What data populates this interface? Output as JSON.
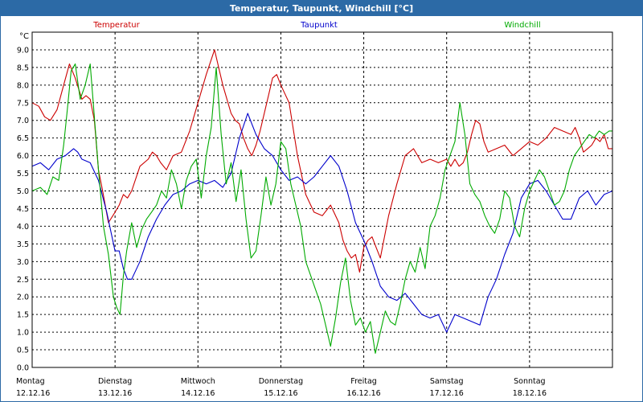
{
  "window": {
    "title": "Temperatur, Taupunkt, Windchill [°C]"
  },
  "chart_data": {
    "type": "line",
    "title": "Temperatur, Taupunkt, Windchill [°C]",
    "ylabel": "°C",
    "ylim": [
      0,
      9.5
    ],
    "yticks": [
      "0.0",
      "0.5",
      "1.0",
      "1.5",
      "2.0",
      "2.5",
      "3.0",
      "3.5",
      "4.0",
      "4.5",
      "5.0",
      "5.5",
      "6.0",
      "6.5",
      "7.0",
      "7.5",
      "8.0",
      "8.5",
      "9.0"
    ],
    "xlim": [
      0,
      7
    ],
    "days": [
      {
        "day": "Montag",
        "date": "12.12.16"
      },
      {
        "day": "Dienstag",
        "date": "13.12.16"
      },
      {
        "day": "Mittwoch",
        "date": "14.12.16"
      },
      {
        "day": "Donnerstag",
        "date": "15.12.16"
      },
      {
        "day": "Freitag",
        "date": "16.12.16"
      },
      {
        "day": "Samstag",
        "date": "17.12.16"
      },
      {
        "day": "Sonntag",
        "date": "18.12.16"
      }
    ],
    "grid": true,
    "series": [
      {
        "name": "Temperatur",
        "color": "#cc0000",
        "x": [
          0.0,
          0.08,
          0.15,
          0.22,
          0.3,
          0.38,
          0.45,
          0.52,
          0.6,
          0.65,
          0.7,
          0.75,
          0.8,
          0.85,
          0.92,
          1.0,
          1.05,
          1.1,
          1.15,
          1.2,
          1.3,
          1.4,
          1.45,
          1.5,
          1.55,
          1.62,
          1.7,
          1.8,
          1.9,
          2.0,
          2.1,
          2.2,
          2.3,
          2.4,
          2.45,
          2.5,
          2.55,
          2.6,
          2.65,
          2.7,
          2.75,
          2.8,
          2.85,
          2.9,
          2.95,
          3.0,
          3.1,
          3.2,
          3.3,
          3.4,
          3.5,
          3.6,
          3.7,
          3.75,
          3.8,
          3.85,
          3.9,
          3.95,
          4.0,
          4.05,
          4.1,
          4.15,
          4.2,
          4.3,
          4.4,
          4.5,
          4.6,
          4.7,
          4.8,
          4.9,
          5.0,
          5.05,
          5.1,
          5.15,
          5.2,
          5.25,
          5.3,
          5.35,
          5.4,
          5.45,
          5.5,
          5.6,
          5.7,
          5.8,
          5.9,
          6.0,
          6.1,
          6.2,
          6.3,
          6.4,
          6.5,
          6.55,
          6.6,
          6.65,
          6.7,
          6.75,
          6.8,
          6.85,
          6.9,
          6.95,
          7.0
        ],
        "y": [
          7.5,
          7.4,
          7.1,
          7.0,
          7.3,
          8.0,
          8.6,
          8.2,
          7.6,
          7.7,
          7.6,
          7.0,
          5.6,
          5.0,
          4.1,
          4.4,
          4.6,
          4.9,
          4.8,
          5.0,
          5.7,
          5.9,
          6.1,
          6.0,
          5.8,
          5.6,
          6.0,
          6.1,
          6.7,
          7.5,
          8.3,
          9.0,
          8.0,
          7.2,
          7.0,
          6.9,
          6.5,
          6.2,
          6.0,
          6.3,
          6.7,
          7.2,
          7.7,
          8.2,
          8.3,
          8.0,
          7.5,
          6.0,
          4.9,
          4.4,
          4.3,
          4.6,
          4.1,
          3.6,
          3.3,
          3.1,
          3.2,
          2.7,
          3.4,
          3.6,
          3.7,
          3.4,
          3.1,
          4.3,
          5.2,
          6.0,
          6.2,
          5.8,
          5.9,
          5.8,
          5.9,
          5.7,
          5.9,
          5.7,
          5.8,
          6.1,
          6.6,
          7.0,
          6.9,
          6.4,
          6.1,
          6.2,
          6.3,
          6.0,
          6.2,
          6.4,
          6.3,
          6.5,
          6.8,
          6.7,
          6.6,
          6.8,
          6.5,
          6.1,
          6.2,
          6.3,
          6.5,
          6.4,
          6.6,
          6.2,
          6.2
        ]
      },
      {
        "name": "Taupunkt",
        "color": "#0000cc",
        "x": [
          0.0,
          0.1,
          0.2,
          0.3,
          0.4,
          0.5,
          0.55,
          0.6,
          0.7,
          0.8,
          0.9,
          1.0,
          1.05,
          1.1,
          1.15,
          1.2,
          1.3,
          1.4,
          1.5,
          1.6,
          1.7,
          1.8,
          1.9,
          2.0,
          2.1,
          2.2,
          2.3,
          2.4,
          2.5,
          2.6,
          2.7,
          2.8,
          2.9,
          3.0,
          3.1,
          3.2,
          3.3,
          3.4,
          3.5,
          3.6,
          3.7,
          3.8,
          3.9,
          4.0,
          4.1,
          4.2,
          4.3,
          4.4,
          4.5,
          4.6,
          4.7,
          4.8,
          4.9,
          5.0,
          5.1,
          5.2,
          5.3,
          5.4,
          5.5,
          5.6,
          5.7,
          5.8,
          5.9,
          6.0,
          6.1,
          6.2,
          6.3,
          6.4,
          6.5,
          6.6,
          6.7,
          6.8,
          6.9,
          7.0
        ],
        "y": [
          5.7,
          5.8,
          5.6,
          5.9,
          6.0,
          6.2,
          6.1,
          5.9,
          5.8,
          5.3,
          4.4,
          3.3,
          3.3,
          2.8,
          2.5,
          2.5,
          3.0,
          3.7,
          4.2,
          4.6,
          4.9,
          5.0,
          5.2,
          5.3,
          5.2,
          5.3,
          5.1,
          5.5,
          6.5,
          7.2,
          6.6,
          6.2,
          6.0,
          5.6,
          5.3,
          5.4,
          5.2,
          5.4,
          5.7,
          6.0,
          5.7,
          5.0,
          4.1,
          3.6,
          3.0,
          2.3,
          2.0,
          1.9,
          2.1,
          1.8,
          1.5,
          1.4,
          1.5,
          1.0,
          1.5,
          1.4,
          1.3,
          1.2,
          2.0,
          2.5,
          3.2,
          3.8,
          4.8,
          5.2,
          5.3,
          5.0,
          4.6,
          4.2,
          4.2,
          4.8,
          5.0,
          4.6,
          4.9,
          5.0
        ]
      },
      {
        "name": "Windchill",
        "color": "#00aa00",
        "x": [
          0.0,
          0.1,
          0.18,
          0.25,
          0.32,
          0.38,
          0.42,
          0.47,
          0.52,
          0.58,
          0.64,
          0.7,
          0.75,
          0.8,
          0.86,
          0.92,
          0.98,
          1.02,
          1.06,
          1.1,
          1.14,
          1.2,
          1.26,
          1.32,
          1.38,
          1.44,
          1.5,
          1.56,
          1.62,
          1.68,
          1.74,
          1.8,
          1.86,
          1.92,
          1.98,
          2.04,
          2.1,
          2.16,
          2.22,
          2.28,
          2.34,
          2.4,
          2.46,
          2.52,
          2.58,
          2.64,
          2.7,
          2.76,
          2.82,
          2.88,
          2.94,
          3.0,
          3.06,
          3.12,
          3.18,
          3.24,
          3.3,
          3.36,
          3.42,
          3.48,
          3.54,
          3.6,
          3.66,
          3.72,
          3.78,
          3.84,
          3.9,
          3.96,
          4.02,
          4.08,
          4.14,
          4.2,
          4.26,
          4.32,
          4.38,
          4.44,
          4.5,
          4.56,
          4.62,
          4.68,
          4.74,
          4.8,
          4.86,
          4.92,
          4.98,
          5.04,
          5.1,
          5.16,
          5.22,
          5.28,
          5.34,
          5.4,
          5.46,
          5.52,
          5.58,
          5.64,
          5.7,
          5.76,
          5.82,
          5.88,
          5.94,
          6.0,
          6.06,
          6.12,
          6.18,
          6.24,
          6.3,
          6.36,
          6.42,
          6.48,
          6.54,
          6.6,
          6.66,
          6.72,
          6.78,
          6.84,
          6.9,
          6.96,
          7.0
        ],
        "y": [
          5.0,
          5.1,
          4.9,
          5.4,
          5.3,
          6.3,
          7.2,
          8.4,
          8.6,
          7.6,
          8.0,
          8.6,
          7.1,
          5.6,
          4.0,
          3.2,
          2.0,
          1.7,
          1.5,
          2.6,
          3.3,
          4.1,
          3.4,
          3.9,
          4.2,
          4.4,
          4.6,
          5.0,
          4.8,
          5.6,
          5.2,
          4.5,
          5.3,
          5.7,
          5.9,
          4.8,
          6.0,
          6.8,
          8.5,
          6.6,
          5.2,
          5.8,
          4.7,
          5.6,
          4.2,
          3.1,
          3.3,
          4.3,
          5.4,
          4.6,
          5.2,
          6.4,
          6.2,
          5.2,
          4.6,
          4.0,
          3.0,
          2.6,
          2.2,
          1.8,
          1.2,
          0.6,
          1.4,
          2.4,
          3.1,
          1.9,
          1.2,
          1.4,
          1.0,
          1.3,
          0.4,
          1.0,
          1.6,
          1.3,
          1.2,
          1.8,
          2.5,
          3.0,
          2.7,
          3.4,
          2.8,
          4.0,
          4.3,
          4.8,
          5.6,
          6.0,
          6.4,
          7.5,
          6.6,
          5.2,
          4.9,
          4.7,
          4.3,
          4.0,
          3.8,
          4.2,
          5.0,
          4.8,
          4.0,
          3.7,
          4.5,
          5.0,
          5.3,
          5.6,
          5.4,
          5.0,
          4.6,
          4.7,
          5.0,
          5.6,
          6.0,
          6.2,
          6.4,
          6.6,
          6.5,
          6.7,
          6.6,
          6.7,
          6.7
        ]
      }
    ]
  }
}
